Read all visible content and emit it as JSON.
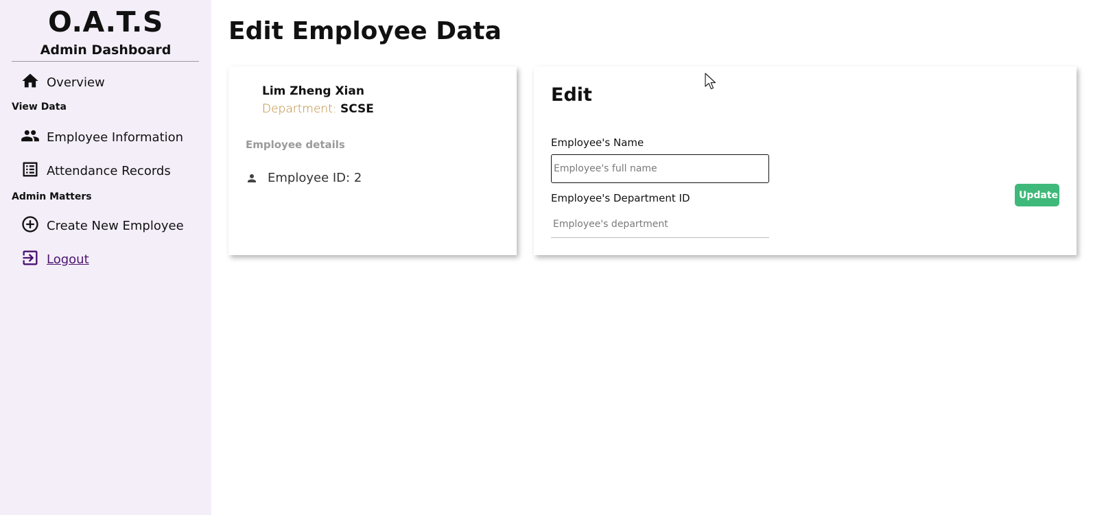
{
  "sidebar": {
    "brand": "O.A.T.S",
    "subtitle": "Admin Dashboard",
    "overview": {
      "label": "Overview",
      "icon": "home-icon"
    },
    "view_data_heading": "View Data",
    "employee_info": {
      "label": "Employee Information",
      "icon": "people-icon"
    },
    "attendance": {
      "label": "Attendance Records",
      "icon": "list-icon"
    },
    "admin_heading": "Admin Matters",
    "create_employee": {
      "label": "Create New Employee",
      "icon": "add-circle-icon"
    },
    "logout": {
      "label": "Logout",
      "icon": "logout-icon",
      "color": "#4a1370"
    }
  },
  "main": {
    "title": "Edit Employee Data",
    "profile": {
      "name": "Lim Zheng Xian",
      "department_key": "Department:",
      "department_value": "SCSE",
      "details_heading": "Employee details",
      "employee_id": "Employee ID: 2"
    },
    "edit": {
      "heading": "Edit",
      "name_label": "Employee's Name",
      "name_placeholder": "Employee's full name",
      "name_value": "",
      "dept_label": "Employee's Department ID",
      "dept_placeholder": "Employee's department",
      "dept_value": "",
      "update_label": "Update",
      "update_color": "#3fb97a"
    }
  },
  "colors": {
    "sidebar_bg": "#f4eef9",
    "department_key": "#b8862d"
  }
}
